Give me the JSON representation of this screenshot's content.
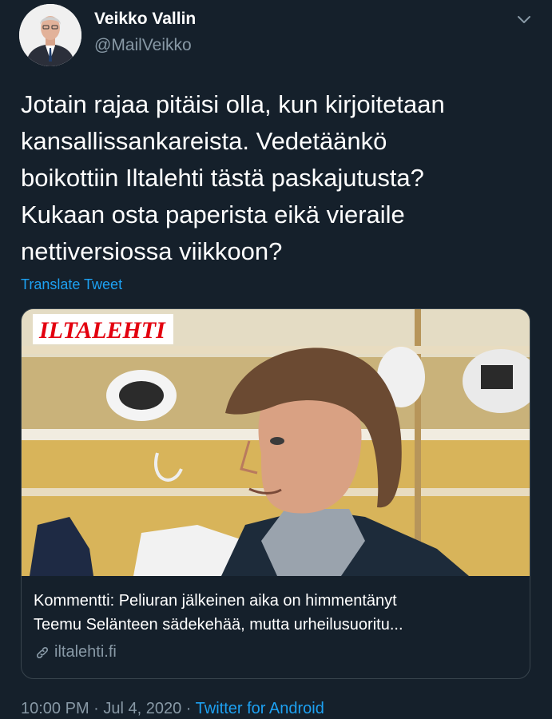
{
  "author": {
    "name": "Veikko Vallin",
    "handle": "@MailVeikko"
  },
  "tweet": {
    "lines": [
      "Jotain rajaa pitäisi olla, kun kirjoitetaan",
      "kansallissankareista. Vedetäänkö",
      "boikottiin Iltalehti tästä paskajutusta?",
      "Kukaan osta paperista eikä vieraile",
      "nettiversiossa viikkoon?"
    ],
    "translate_label": "Translate Tweet"
  },
  "card": {
    "logo_text": "ILTALEHTI",
    "title_lines": [
      "Kommentti: Peliuran jälkeinen aika on himmentänyt",
      "Teemu Selänteen sädekehää, mutta urheilusuoritu..."
    ],
    "domain": "iltalehti.fi",
    "logo_color": "#e3000f"
  },
  "meta": {
    "time": "10:00 PM",
    "separator": " · ",
    "date": "Jul 4, 2020",
    "source": "Twitter for Android"
  },
  "icons": {
    "caret": "chevron-down-icon",
    "link": "link-icon"
  },
  "colors": {
    "background": "#15202b",
    "accent": "#1da1f2",
    "secondary_text": "#8899a6",
    "border": "#38444d"
  }
}
